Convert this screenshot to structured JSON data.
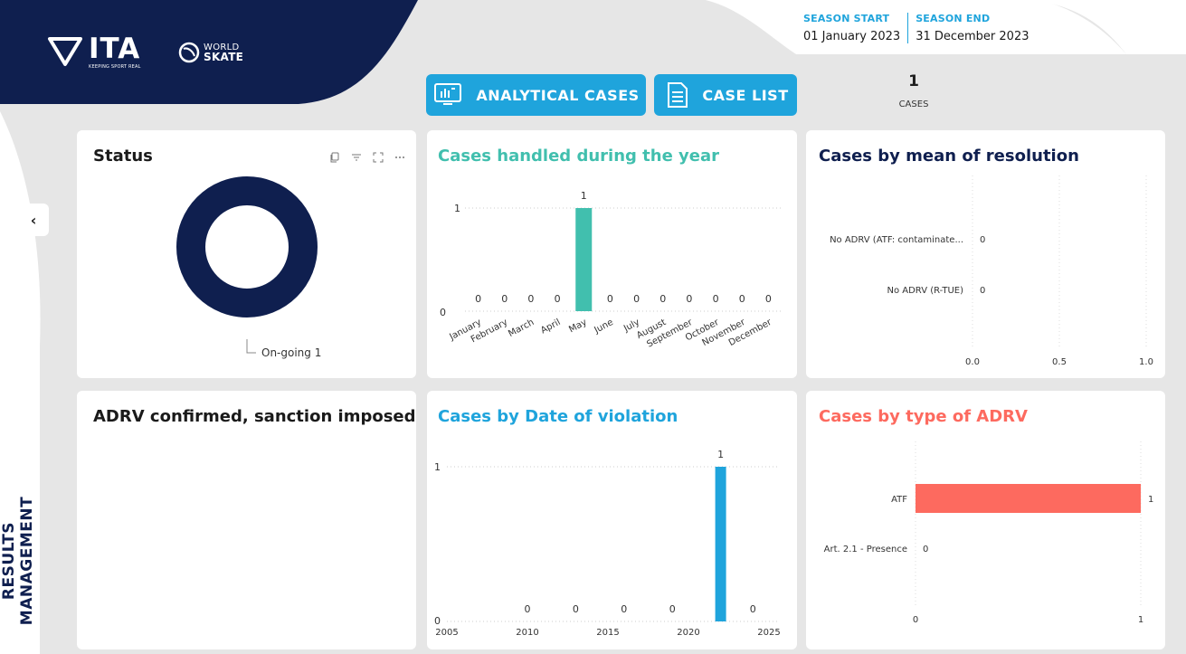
{
  "header": {
    "brand": "ITA",
    "brand_tagline": "KEEPING SPORT REAL",
    "partner_top": "WORLD",
    "partner_bottom": "SKATE",
    "season_start_label": "SEASON START",
    "season_start_value": "01 January 2023",
    "season_end_label": "SEASON END",
    "season_end_value": "31 December 2023",
    "nav_analytical": "ANALYTICAL CASES",
    "nav_caselist": "CASE LIST",
    "cases_count": "1",
    "cases_caption": "CASES",
    "side_toggle": "‹",
    "vertical_label": "RESULTS MANAGEMENT"
  },
  "colors": {
    "navy": "#0f1f4f",
    "accent_blue": "#1fa4dc",
    "teal": "#41bfae",
    "coral": "#fd6a5f"
  },
  "status_card": {
    "title": "Status",
    "icons": [
      "copy-icon",
      "filter-icon",
      "focus-icon",
      "more-icon"
    ],
    "legend_label": "On-going 1"
  },
  "adrv_card": {
    "title": "ADRV confirmed, sanction imposed"
  },
  "chart_data": [
    {
      "id": "status",
      "type": "pie",
      "variant": "donut",
      "title": "Status",
      "slices": [
        {
          "label": "On-going",
          "value": 1,
          "color": "#0f1f4f"
        }
      ]
    },
    {
      "id": "year",
      "type": "bar",
      "title": "Cases handled during the year",
      "categories": [
        "January",
        "February",
        "March",
        "April",
        "May",
        "June",
        "July",
        "August",
        "September",
        "October",
        "November",
        "December"
      ],
      "values": [
        0,
        0,
        0,
        0,
        1,
        0,
        0,
        0,
        0,
        0,
        0,
        0
      ],
      "ylim": [
        0,
        1
      ],
      "yticks": [
        "0",
        "1"
      ],
      "color": "#41bfae",
      "grid": true
    },
    {
      "id": "resolution",
      "type": "bar",
      "orientation": "horizontal",
      "title": "Cases by mean of resolution",
      "categories": [
        "No ADRV (ATF: contaminate...",
        "No ADRV (R-TUE)"
      ],
      "values": [
        0,
        0
      ],
      "xlim": [
        0,
        1
      ],
      "xticks": [
        "0.0",
        "0.5",
        "1.0"
      ],
      "color": "#0f1f4f",
      "grid": true
    },
    {
      "id": "violation",
      "type": "bar",
      "title": "Cases by Date of violation",
      "x": [
        2010,
        2013,
        2016,
        2019,
        2022,
        2024
      ],
      "values": [
        0,
        0,
        0,
        0,
        1,
        0
      ],
      "value_labels": [
        "0",
        "0",
        "0",
        "0",
        "1",
        "0"
      ],
      "xlim": [
        2005,
        2025
      ],
      "xticks": [
        "2005",
        "2010",
        "2015",
        "2020",
        "2025"
      ],
      "ylim": [
        0,
        1
      ],
      "yticks": [
        "0",
        "1"
      ],
      "color": "#1fa4dc",
      "grid": true
    },
    {
      "id": "adrvtype",
      "type": "bar",
      "orientation": "horizontal",
      "title": "Cases by type of ADRV",
      "categories": [
        "ATF",
        "Art. 2.1 - Presence"
      ],
      "values": [
        1,
        0
      ],
      "xlim": [
        0,
        1
      ],
      "xticks": [
        "0",
        "1"
      ],
      "color": "#fd6a5f",
      "grid": true
    }
  ]
}
